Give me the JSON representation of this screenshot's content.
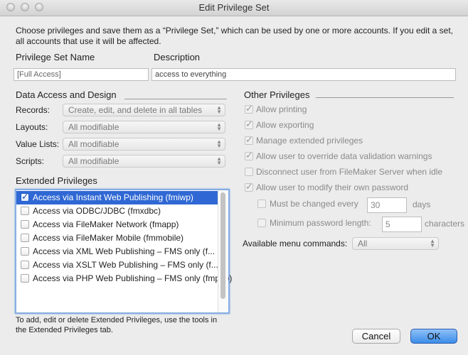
{
  "window": {
    "title": "Edit Privilege Set"
  },
  "intro": "Choose privileges and save them as a “Privilege Set,” which can be used by one or more accounts. If you edit a set, all accounts that use it will be affected.",
  "name_field": {
    "label": "Privilege Set Name",
    "value": "[Full Access]"
  },
  "description_field": {
    "label": "Description",
    "value": "access to everything"
  },
  "data_access": {
    "header": "Data Access and Design",
    "rows": [
      {
        "label": "Records:",
        "value": "Create, edit, and delete in all tables"
      },
      {
        "label": "Layouts:",
        "value": "All modifiable"
      },
      {
        "label": "Value Lists:",
        "value": "All modifiable"
      },
      {
        "label": "Scripts:",
        "value": "All modifiable"
      }
    ]
  },
  "extended": {
    "header": "Extended Privileges",
    "items": [
      {
        "label": "Access via Instant Web Publishing (fmiwp)",
        "checked": true,
        "selected": true
      },
      {
        "label": "Access via ODBC/JDBC (fmxdbc)",
        "checked": false
      },
      {
        "label": "Access via FileMaker Network (fmapp)",
        "checked": false
      },
      {
        "label": "Access via FileMaker Mobile (fmmobile)",
        "checked": false
      },
      {
        "label": "Access via XML Web Publishing – FMS only (f...",
        "checked": false
      },
      {
        "label": "Access via XSLT Web Publishing – FMS only (f...",
        "checked": false
      },
      {
        "label": "Access via PHP Web Publishing – FMS only (fmphp)",
        "checked": false
      }
    ],
    "footnote": "To add, edit or delete Extended Privileges, use the tools in the Extended Privileges tab."
  },
  "other": {
    "header": "Other Privileges",
    "items": [
      {
        "label": "Allow printing",
        "checked": true
      },
      {
        "label": "Allow exporting",
        "checked": true
      },
      {
        "label": "Manage extended privileges",
        "checked": true
      },
      {
        "label": "Allow user to override data validation warnings",
        "checked": true
      },
      {
        "label": "Disconnect user from FileMaker Server when idle",
        "checked": false
      },
      {
        "label": "Allow user to modify their own password",
        "checked": true
      }
    ],
    "must_change": {
      "label": "Must be changed every",
      "value": "30",
      "unit": "days"
    },
    "min_length": {
      "label": "Minimum password length:",
      "value": "5",
      "unit": "characters"
    },
    "menu_commands": {
      "label": "Available menu commands:",
      "value": "All"
    }
  },
  "buttons": {
    "cancel": "Cancel",
    "ok": "OK"
  }
}
